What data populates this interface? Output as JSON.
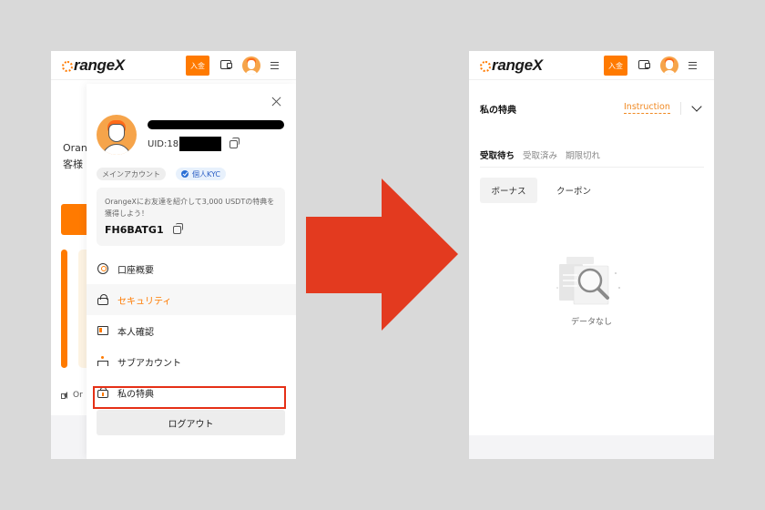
{
  "header": {
    "logo_text": "rangeX",
    "deposit_label": "入金"
  },
  "left_background": {
    "line1": "Oran",
    "line2": "客様",
    "announcement": "Or"
  },
  "profile": {
    "uid_prefix": "UID:18",
    "tags": {
      "account_type": "メインアカウント",
      "kyc": "個人KYC"
    },
    "referral": {
      "description": "OrangeXにお友達を紹介して3,000 USDTの特典を獲得しよう！",
      "code": "FH6BATG1"
    }
  },
  "account_menu": {
    "items": [
      {
        "label": "口座概要",
        "icon": "account-overview-icon",
        "active": false
      },
      {
        "label": "セキュリティ",
        "icon": "lock-icon",
        "active": true
      },
      {
        "label": "本人確認",
        "icon": "id-card-icon",
        "active": false
      },
      {
        "label": "サブアカウント",
        "icon": "sub-account-icon",
        "active": false
      },
      {
        "label": "私の特典",
        "icon": "gift-bag-icon",
        "active": false,
        "highlighted": true
      }
    ],
    "logout_label": "ログアウト"
  },
  "rewards_page": {
    "title": "私の特典",
    "instruction_label": "Instruction",
    "tabs": [
      {
        "label": "受取待ち",
        "active": true
      },
      {
        "label": "受取済み",
        "active": false
      },
      {
        "label": "期限切れ",
        "active": false
      }
    ],
    "filters": [
      {
        "label": "ボーナス",
        "active": true
      },
      {
        "label": "クーポン",
        "active": false
      }
    ],
    "empty_text": "データなし"
  },
  "colors": {
    "brand": "#ff7a00",
    "highlight": "#e53016",
    "arrow": "#e33a1f",
    "link": "#f08a24"
  }
}
